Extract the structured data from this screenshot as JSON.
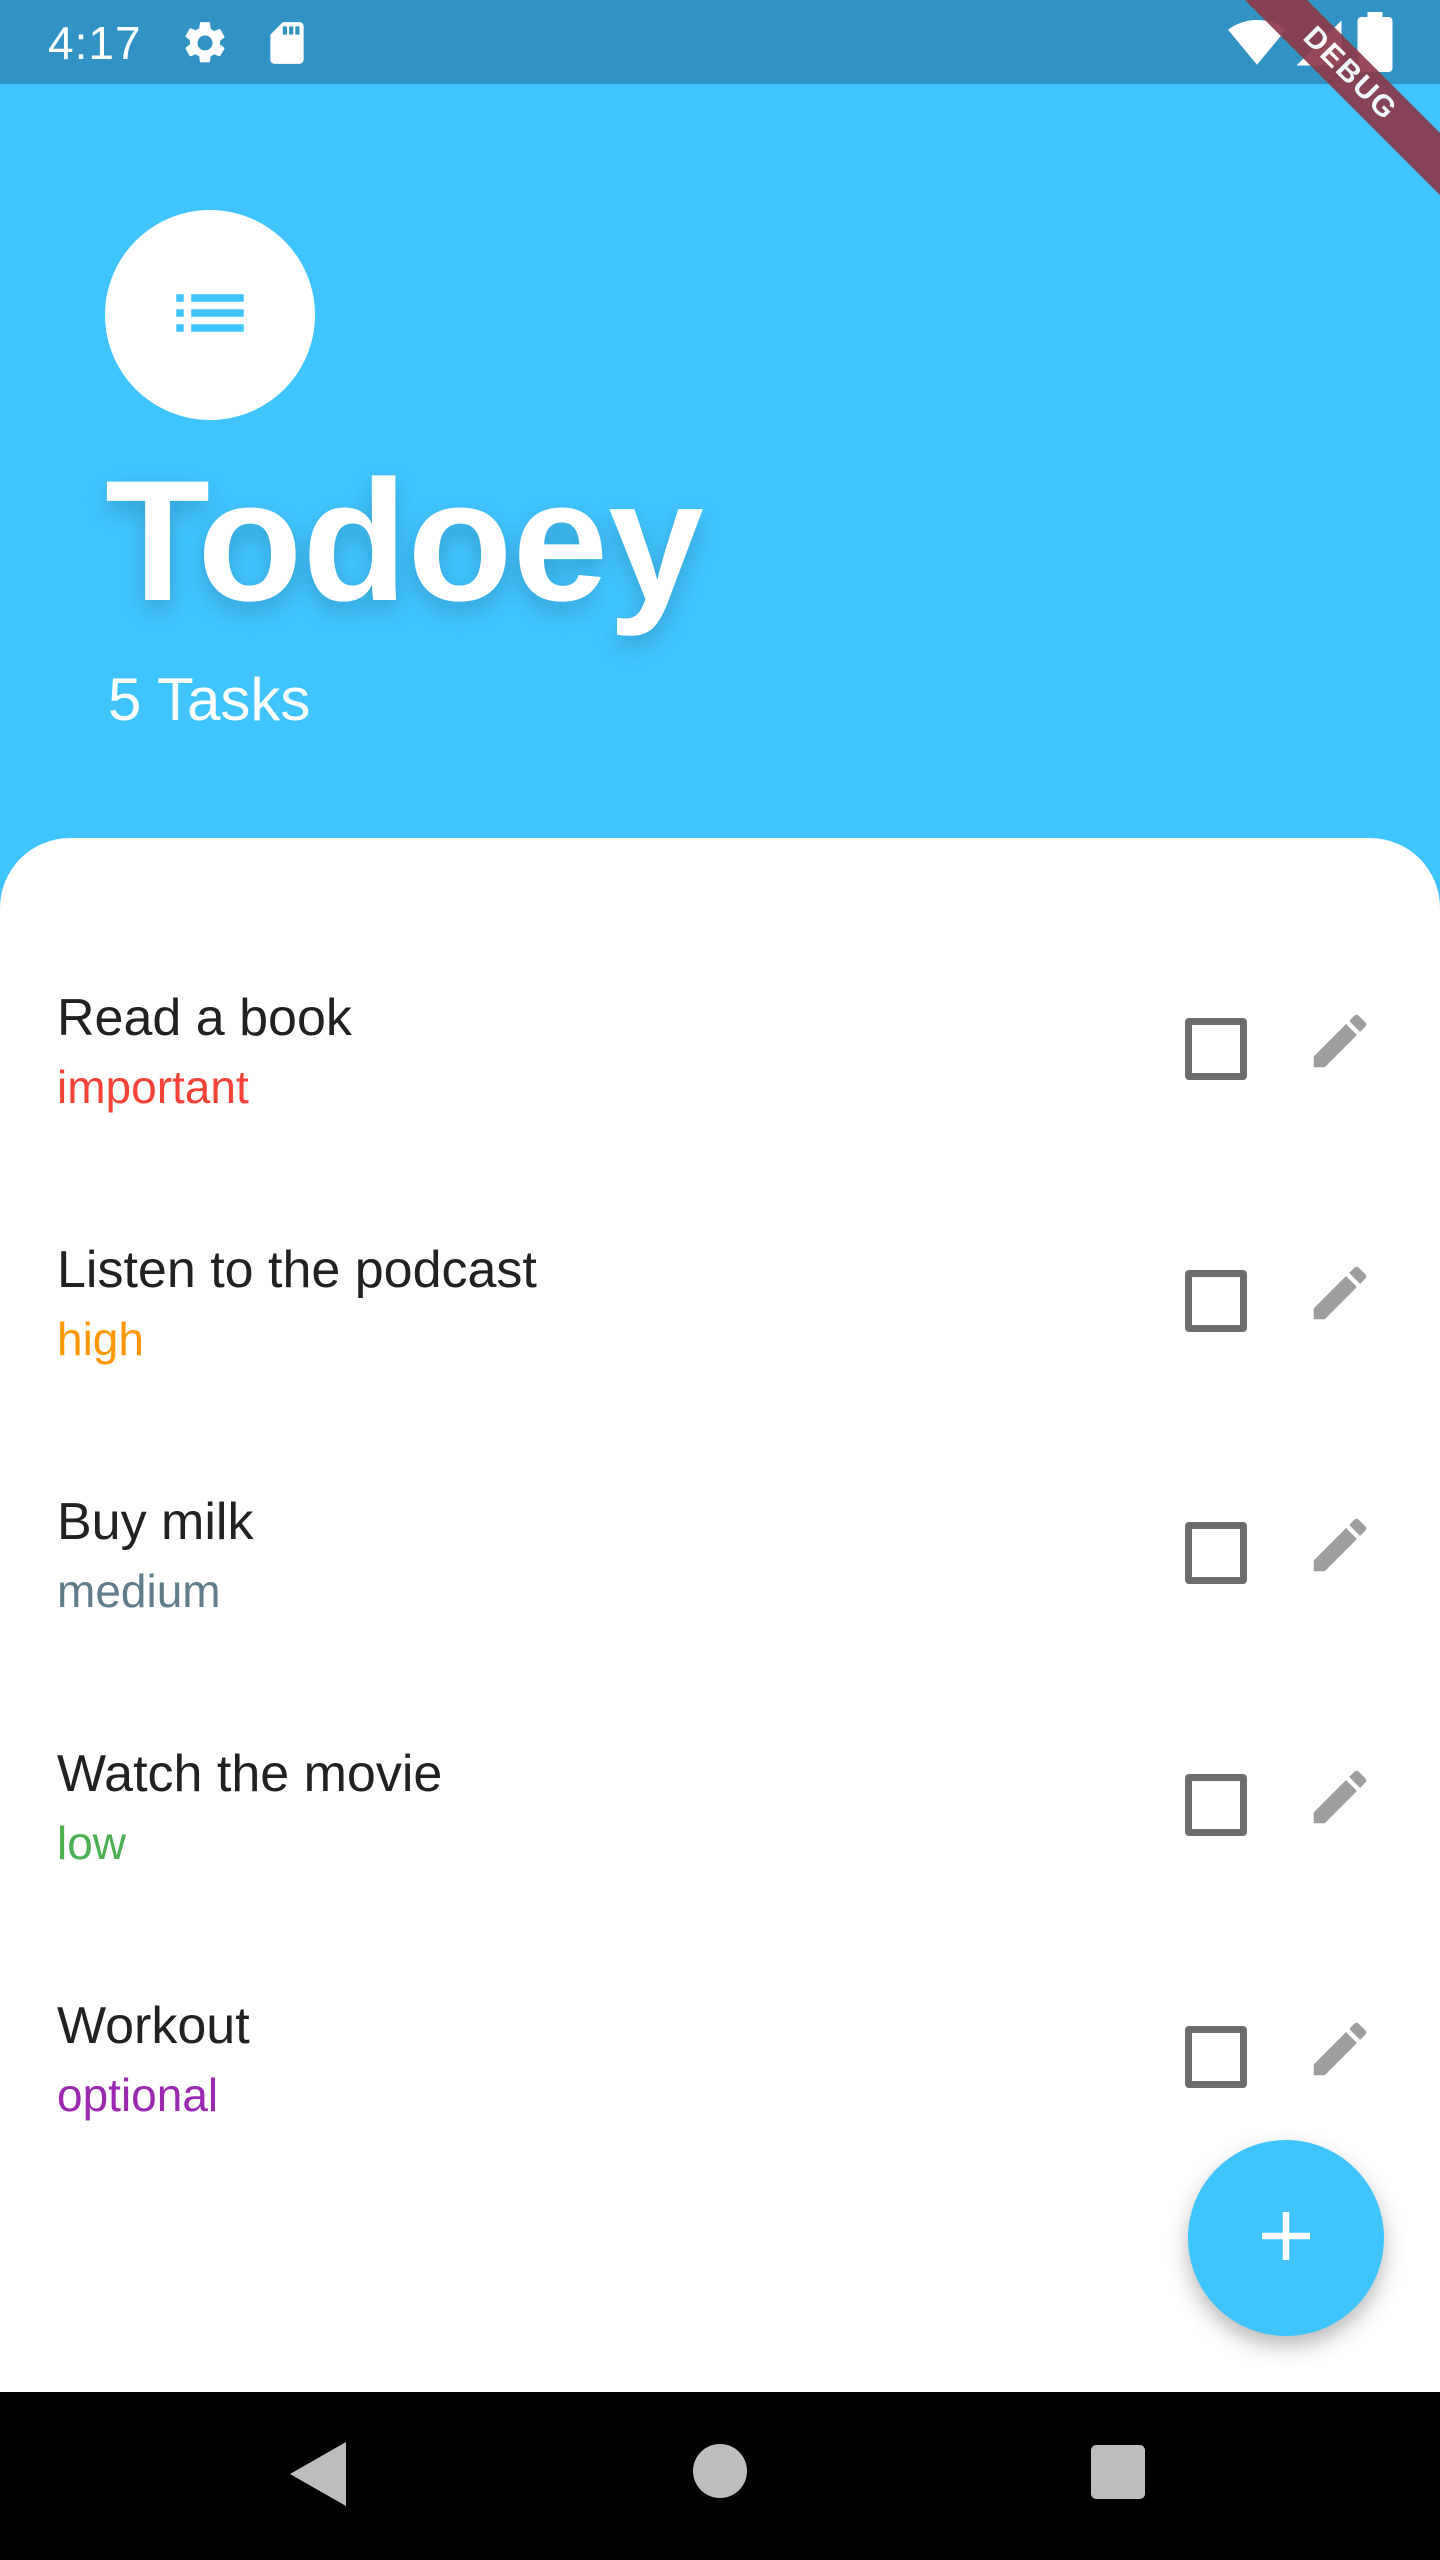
{
  "status_bar": {
    "time": "4:17",
    "icons": [
      "settings-icon",
      "sd-card-icon",
      "wifi-icon",
      "signal-icon",
      "battery-icon"
    ],
    "color": "#3193C3"
  },
  "debug_banner": {
    "label": "DEBUG",
    "color": "#8E3A4A"
  },
  "header": {
    "logo_icon": "list-icon",
    "title": "Todoey",
    "subtitle": "5 Tasks",
    "background": "#40C4FF"
  },
  "tasks": [
    {
      "title": "Read a book",
      "priority": "important",
      "priority_color": "#F44336",
      "checked": false
    },
    {
      "title": "Listen to the podcast",
      "priority": "high",
      "priority_color": "#FF9800",
      "checked": false
    },
    {
      "title": "Buy milk",
      "priority": "medium",
      "priority_color": "#607D8B",
      "checked": false
    },
    {
      "title": "Watch the movie",
      "priority": "low",
      "priority_color": "#4CAF50",
      "checked": false
    },
    {
      "title": "Workout",
      "priority": "optional",
      "priority_color": "#9C27B0",
      "checked": false
    }
  ],
  "fab": {
    "icon": "plus-icon",
    "color": "#40C4FF"
  },
  "nav_bar": {
    "buttons": [
      "back-icon",
      "home-icon",
      "recents-icon"
    ]
  }
}
